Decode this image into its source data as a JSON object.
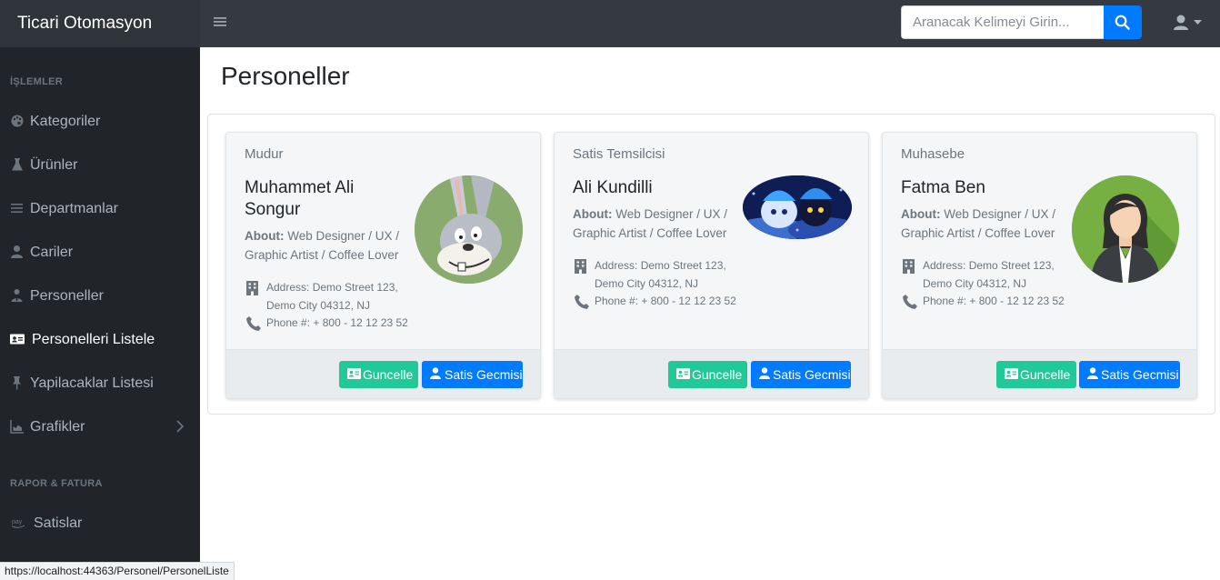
{
  "app": {
    "brand": "Ticari Otomasyon"
  },
  "search": {
    "placeholder": "Aranacak Kelimeyi Girin..."
  },
  "sidebar": {
    "heading1": "İŞLEMLER",
    "items": [
      {
        "label": "Kategoriler",
        "icon": "palette-icon"
      },
      {
        "label": "Ürünler",
        "icon": "flask-icon"
      },
      {
        "label": "Departmanlar",
        "icon": "bars-icon"
      },
      {
        "label": "Cariler",
        "icon": "user-icon"
      },
      {
        "label": "Personeller",
        "icon": "user-tie-icon"
      },
      {
        "label": "Personelleri Listele",
        "icon": "id-card-icon",
        "active": true
      },
      {
        "label": "Yapilacaklar Listesi",
        "icon": "thumbtack-icon"
      },
      {
        "label": "Grafikler",
        "icon": "chart-area-icon"
      }
    ],
    "heading2": "RAPOR & FATURA",
    "items2": [
      {
        "label": "Satislar",
        "icon": "amazon-pay-icon"
      }
    ]
  },
  "main": {
    "title": "Personeller",
    "cards": [
      {
        "role": "Mudur",
        "name": "Muhammet Ali Songur",
        "about_label": "About:",
        "about_text": "Web Designer / UX / Graphic Artist / Coffee Lover",
        "address": "Address: Demo Street 123, Demo City 04312, NJ",
        "phone": "Phone #: + 800 - 12 12 23 52",
        "update_label": "Guncelle",
        "history_label": "Satis Gecmisi"
      },
      {
        "role": "Satis Temsilcisi",
        "name": "Ali Kundilli",
        "about_label": "About:",
        "about_text": "Web Designer / UX / Graphic Artist / Coffee Lover",
        "address": "Address: Demo Street 123, Demo City 04312, NJ",
        "phone": "Phone #: + 800 - 12 12 23 52",
        "update_label": "Guncelle",
        "history_label": "Satis Gecmisi"
      },
      {
        "role": "Muhasebe",
        "name": "Fatma Ben",
        "about_label": "About:",
        "about_text": "Web Designer / UX / Graphic Artist / Coffee Lover",
        "address": "Address: Demo Street 123, Demo City 04312, NJ",
        "phone": "Phone #: + 800 - 12 12 23 52",
        "update_label": "Guncelle",
        "history_label": "Satis Gecmisi"
      }
    ]
  },
  "status_url": "https://localhost:44363/Personel/PersonelListe",
  "colors": {
    "primary": "#007bff",
    "success": "#20c997",
    "sidebar": "#212529",
    "navbar": "#343a40"
  }
}
